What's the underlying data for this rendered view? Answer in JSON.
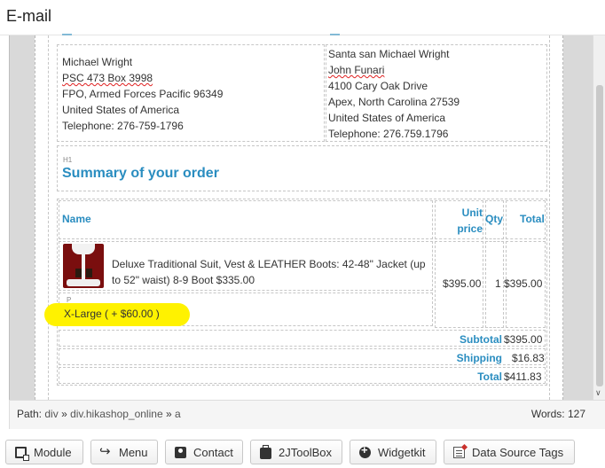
{
  "window": {
    "title": "E-mail"
  },
  "billing": {
    "lines": [
      "Michael Wright",
      "PSC 473 Box 3998",
      "FPO, Armed Forces Pacific 96349",
      "United States of America",
      "Telephone: 276-759-1796"
    ]
  },
  "shipping": {
    "lines": [
      "Santa san Michael Wright",
      "John Funari",
      "4100 Cary Oak Drive",
      "Apex, North Carolina 27539",
      "United States of America",
      "Telephone: 276.759.1796"
    ]
  },
  "summary": {
    "tag": "H1",
    "title": "Summary of your order"
  },
  "table": {
    "headers": {
      "name": "Name",
      "unit_price": "Unit price",
      "qty": "Qty",
      "total": "Total"
    },
    "item": {
      "name": "Deluxe Traditional Suit, Vest & LEATHER Boots: 42-48\" Jacket (up to 52\" waist) 8-9 Boot $335.00",
      "p_tag": "P",
      "option": "X-Large ( + $60.00 )",
      "unit_price": "$395.00",
      "qty": "1",
      "total": "$395.00"
    },
    "totals": [
      {
        "label": "Subtotal",
        "value": "$395.00"
      },
      {
        "label": "Shipping",
        "value": "$16.83"
      },
      {
        "label": "Total",
        "value": "$411.83"
      }
    ]
  },
  "statusbar": {
    "path_label": "Path:",
    "path": [
      "div",
      "div.hikashop_online",
      "a"
    ],
    "separator": "»",
    "words": "Words: 127"
  },
  "buttons": [
    {
      "label": "Module",
      "icon": "module-icon"
    },
    {
      "label": "Menu",
      "icon": "menu-icon"
    },
    {
      "label": "Contact",
      "icon": "contact-icon"
    },
    {
      "label": "2JToolBox",
      "icon": "toolbox-icon"
    },
    {
      "label": "Widgetkit",
      "icon": "plus-circle-icon"
    },
    {
      "label": "Data Source Tags",
      "icon": "data-source-icon"
    }
  ],
  "colors": {
    "accent": "#2a8dc0",
    "highlight": "#fff200"
  }
}
